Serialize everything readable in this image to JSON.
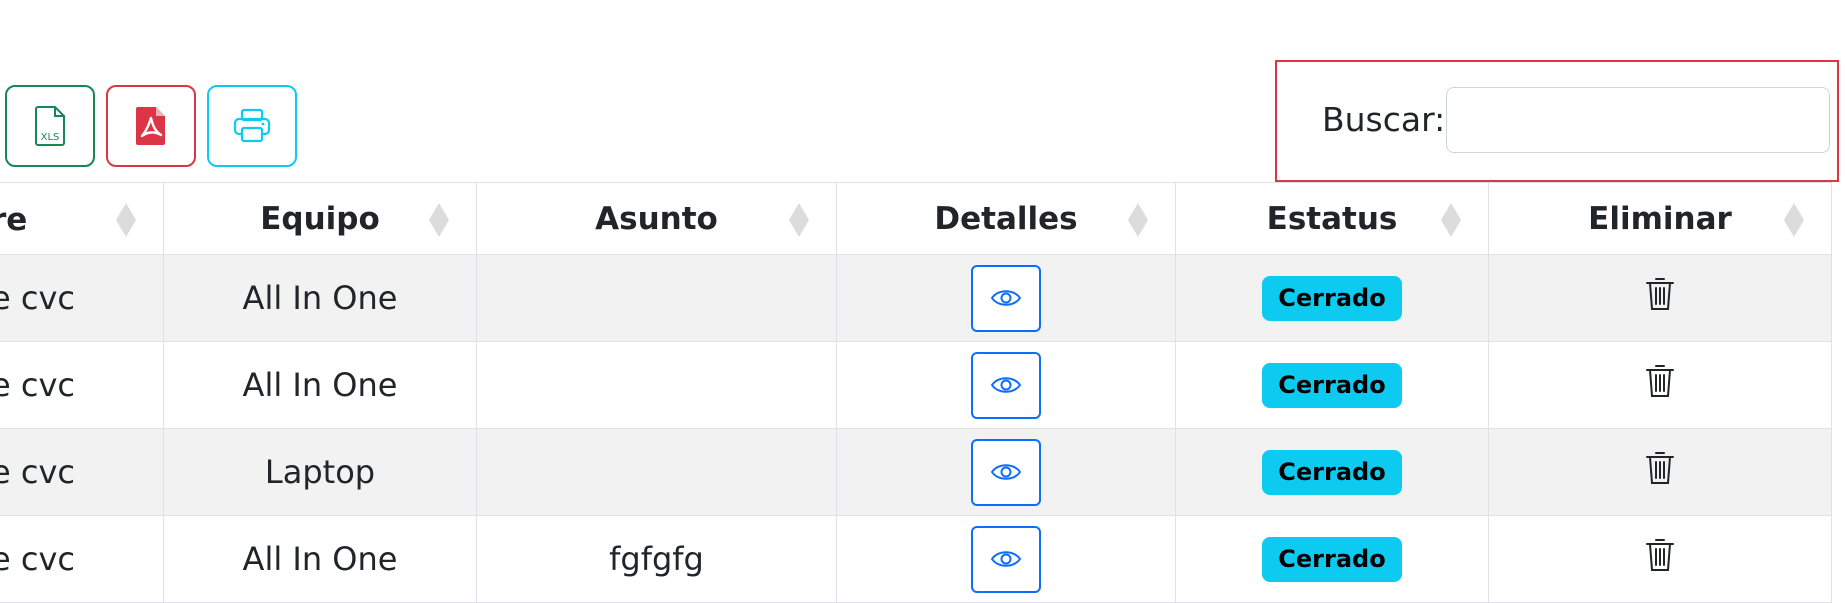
{
  "toolbar": {
    "buttons": [
      {
        "name": "export-xls-button",
        "icon": "xls-file-icon",
        "icon_text": "XLS",
        "color": "#198754"
      },
      {
        "name": "export-pdf-button",
        "icon": "pdf-file-icon",
        "color": "#dc3545"
      },
      {
        "name": "print-button",
        "icon": "printer-icon",
        "color": "#0dcaf0"
      }
    ]
  },
  "search": {
    "label": "Buscar:",
    "value": "",
    "highlight_color": "#dc3545"
  },
  "table": {
    "columns": [
      "re",
      "Equipo",
      "Asunto",
      "Detalles",
      "Estatus",
      "Eliminar"
    ],
    "rows": [
      {
        "nombre": "e cvc",
        "equipo": "All In One",
        "asunto": "",
        "estatus": "Cerrado"
      },
      {
        "nombre": "e cvc",
        "equipo": "All In One",
        "asunto": "",
        "estatus": "Cerrado"
      },
      {
        "nombre": "e cvc",
        "equipo": "Laptop",
        "asunto": "",
        "estatus": "Cerrado"
      },
      {
        "nombre": "e cvc",
        "equipo": "All In One",
        "asunto": "fgfgfg",
        "estatus": "Cerrado"
      }
    ],
    "detail_icon": "eye-icon",
    "delete_icon": "trash-icon",
    "badge_color": "#0dcaf0",
    "detail_button_color": "#0d6efd"
  }
}
